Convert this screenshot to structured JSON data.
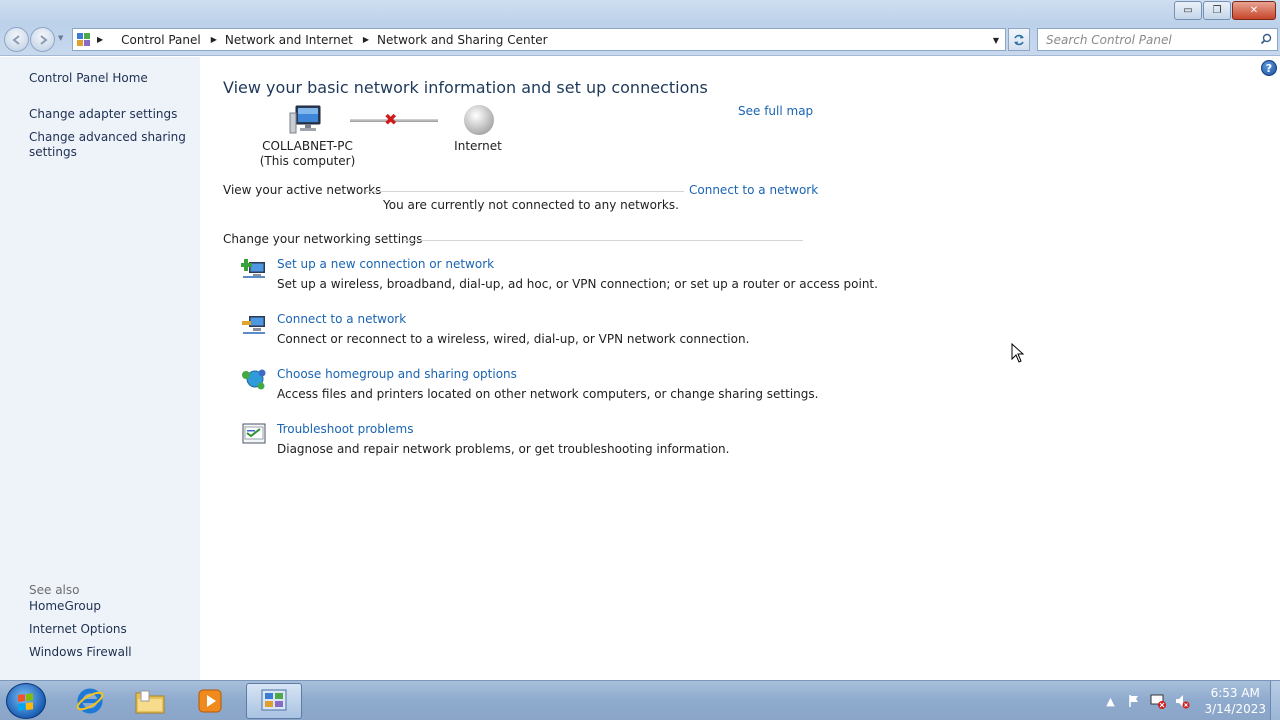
{
  "window": {
    "controls": {
      "minimize": "▭",
      "maximize": "❐",
      "close": "✕"
    }
  },
  "address_bar": {
    "breadcrumbs": [
      "Control Panel",
      "Network and Internet",
      "Network and Sharing Center"
    ],
    "search_placeholder": "Search Control Panel"
  },
  "sidebar": {
    "home": "Control Panel Home",
    "links": [
      "Change adapter settings",
      "Change advanced sharing settings"
    ],
    "see_also_label": "See also",
    "see_also": [
      "HomeGroup",
      "Internet Options",
      "Windows Firewall"
    ]
  },
  "main": {
    "heading": "View your basic network information and set up connections",
    "see_full_map": "See full map",
    "computer_name": "COLLABNET-PC",
    "computer_sub": "(This computer)",
    "internet_label": "Internet",
    "active_networks_label": "View your active networks",
    "connect_link": "Connect to a network",
    "not_connected": "You are currently not connected to any networks.",
    "settings_label": "Change your networking settings",
    "tasks": [
      {
        "title": "Set up a new connection or network",
        "desc": "Set up a wireless, broadband, dial-up, ad hoc, or VPN connection; or set up a router or access point.",
        "icon": "new-connection-icon"
      },
      {
        "title": "Connect to a network",
        "desc": "Connect or reconnect to a wireless, wired, dial-up, or VPN network connection.",
        "icon": "connect-network-icon"
      },
      {
        "title": "Choose homegroup and sharing options",
        "desc": "Access files and printers located on other network computers, or change sharing settings.",
        "icon": "homegroup-icon"
      },
      {
        "title": "Troubleshoot problems",
        "desc": "Diagnose and repair network problems, or get troubleshooting information.",
        "icon": "troubleshoot-icon"
      }
    ]
  },
  "taskbar": {
    "clock_time": "6:53 AM",
    "clock_date": "3/14/2023"
  },
  "colors": {
    "link": "#1a64b3",
    "heading": "#1e395b",
    "sidebar_bg": "#eef3fa",
    "error_x": "#d11a1a"
  }
}
